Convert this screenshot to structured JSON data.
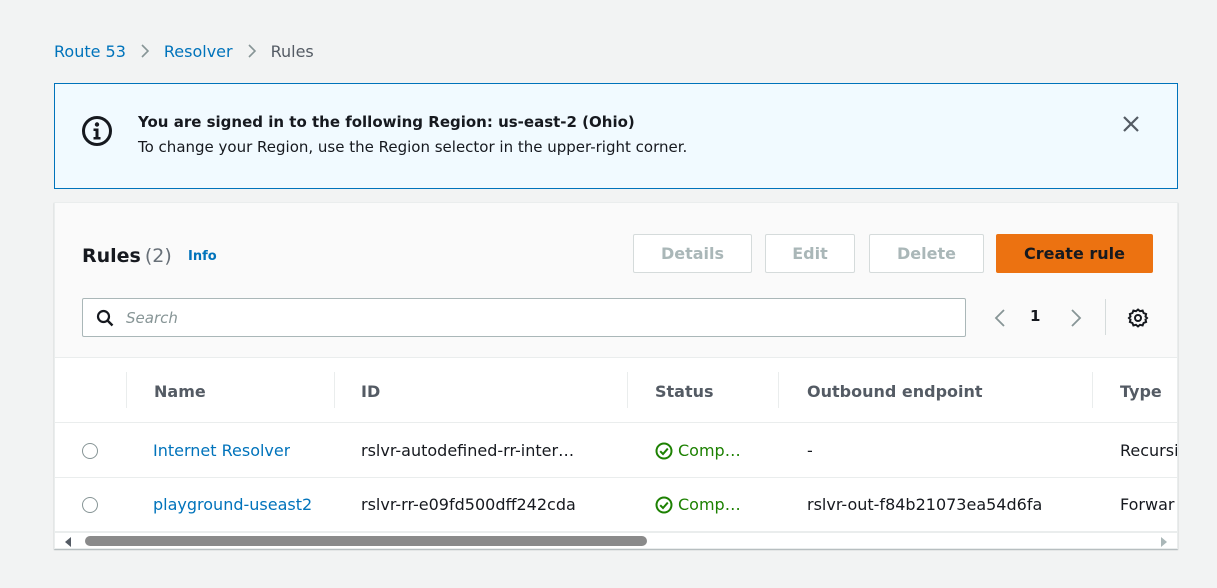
{
  "breadcrumb": {
    "items": [
      "Route 53",
      "Resolver",
      "Rules"
    ]
  },
  "flash": {
    "title": "You are signed in to the following Region: us-east-2 (Ohio)",
    "text": "To change your Region, use the Region selector in the upper-right corner.",
    "icon": "info-icon",
    "color": "#0073bb"
  },
  "rules": {
    "title": "Rules",
    "count": "(2)",
    "info": "Info",
    "buttons": {
      "details": "Details",
      "edit": "Edit",
      "delete": "Delete",
      "create": "Create rule"
    },
    "accent": "#ec7211"
  },
  "search": {
    "placeholder": "Search",
    "value": ""
  },
  "pagination": {
    "current": "1"
  },
  "table": {
    "columns": [
      "Name",
      "ID",
      "Status",
      "Outbound endpoint",
      "Type"
    ],
    "rows": [
      {
        "name": "Internet Resolver",
        "id": "rslvr-autodefined-rr-inter…",
        "status": "Comp…",
        "outbound": "-",
        "type": "Recursi"
      },
      {
        "name": "playground-useast2",
        "id": "rslvr-rr-e09fd500dff242cda",
        "status": "Comp…",
        "outbound": "rslvr-out-f84b21073ea54d6fa",
        "type": "Forwar"
      }
    ],
    "status_color": "#1d8102"
  }
}
